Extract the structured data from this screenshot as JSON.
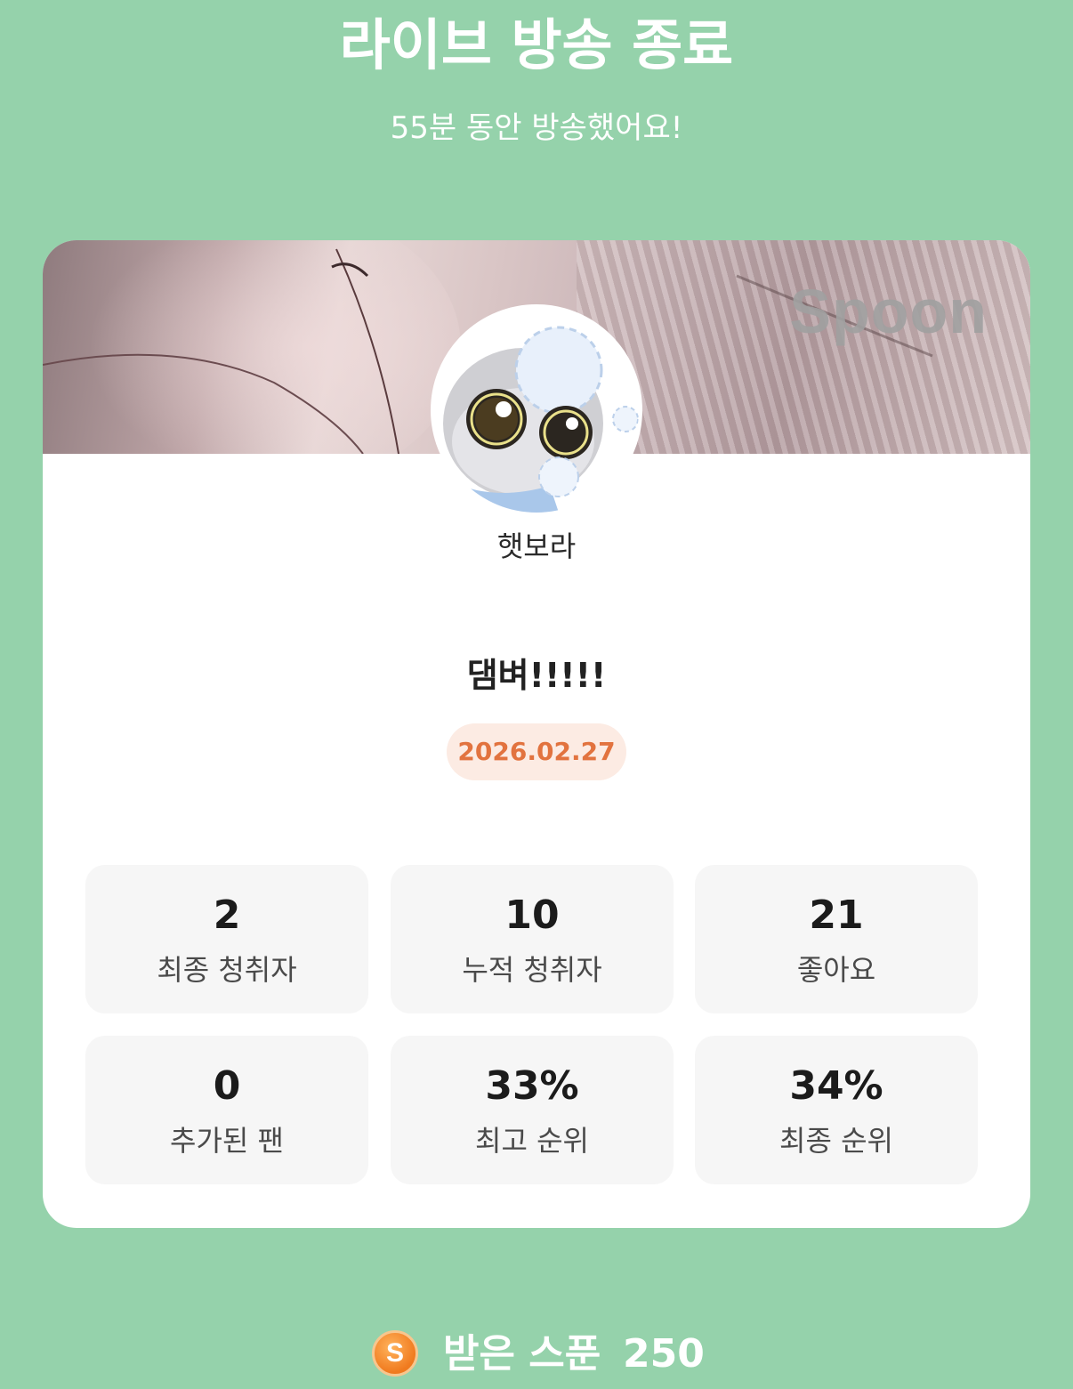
{
  "header": {
    "title": "라이브 방송 종료",
    "subtitle": "55분 동안 방송했어요!"
  },
  "card": {
    "cover_logo": "Spoon",
    "nickname": "햇보라",
    "broadcast_title": "댐벼!!!!!",
    "date": "2026.02.27",
    "stats": [
      {
        "value": "2",
        "label": "최종 청취자"
      },
      {
        "value": "10",
        "label": "누적 청취자"
      },
      {
        "value": "21",
        "label": "좋아요"
      },
      {
        "value": "0",
        "label": "추가된 팬"
      },
      {
        "value": "33%",
        "label": "최고 순위"
      },
      {
        "value": "34%",
        "label": "최종 순위"
      }
    ]
  },
  "spoon": {
    "coin_letter": "S",
    "label": "받은 스푼",
    "count": "250"
  },
  "colors": {
    "background": "#95d2ab",
    "date_text": "#e2733f",
    "date_bg": "#fcebe3",
    "coin": "#f07a1e"
  }
}
